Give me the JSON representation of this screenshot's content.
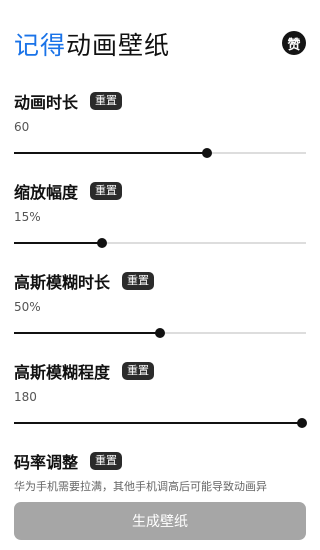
{
  "header": {
    "title_accent": "记得",
    "title_rest": "动画壁纸",
    "zan_label": "赞"
  },
  "settings": [
    {
      "label": "动画时长",
      "reset_label": "重置",
      "value": "60",
      "fraction": 0.66
    },
    {
      "label": "缩放幅度",
      "reset_label": "重置",
      "value": "15%",
      "fraction": 0.3
    },
    {
      "label": "高斯模糊时长",
      "reset_label": "重置",
      "value": "50%",
      "fraction": 0.5
    },
    {
      "label": "高斯模糊程度",
      "reset_label": "重置",
      "value": "180",
      "fraction": 1.0
    }
  ],
  "bitrate": {
    "label": "码率调整",
    "reset_label": "重置",
    "hint": "华为手机需要拉满，其他手机调高后可能导致动画异"
  },
  "generate_label": "生成壁纸",
  "colors": {
    "accent": "#1a73e8",
    "button_disabled": "#a6a6a6"
  }
}
